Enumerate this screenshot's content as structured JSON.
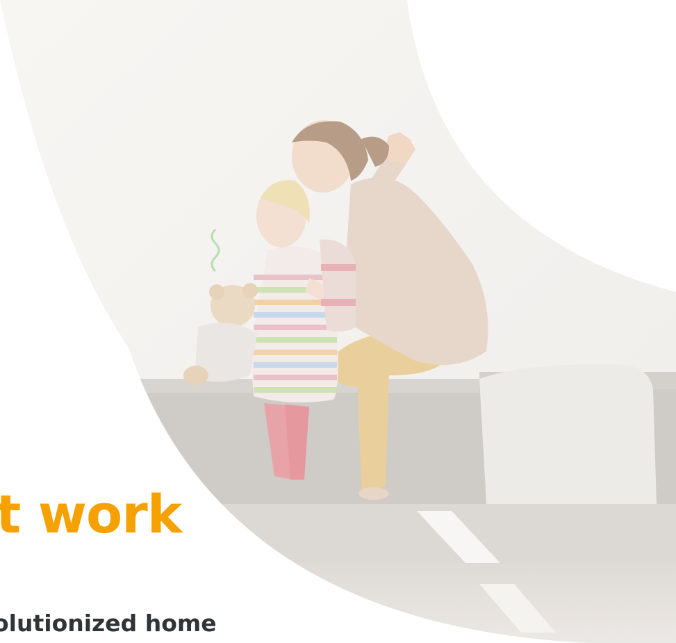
{
  "hero": {
    "headline": "t work",
    "subtext": "olutionized home",
    "photo_alt": "mother-and-child-on-sofa-photo"
  },
  "colors": {
    "accent": "#f5a100",
    "text": "#2f3438",
    "background": "#ffffff"
  }
}
